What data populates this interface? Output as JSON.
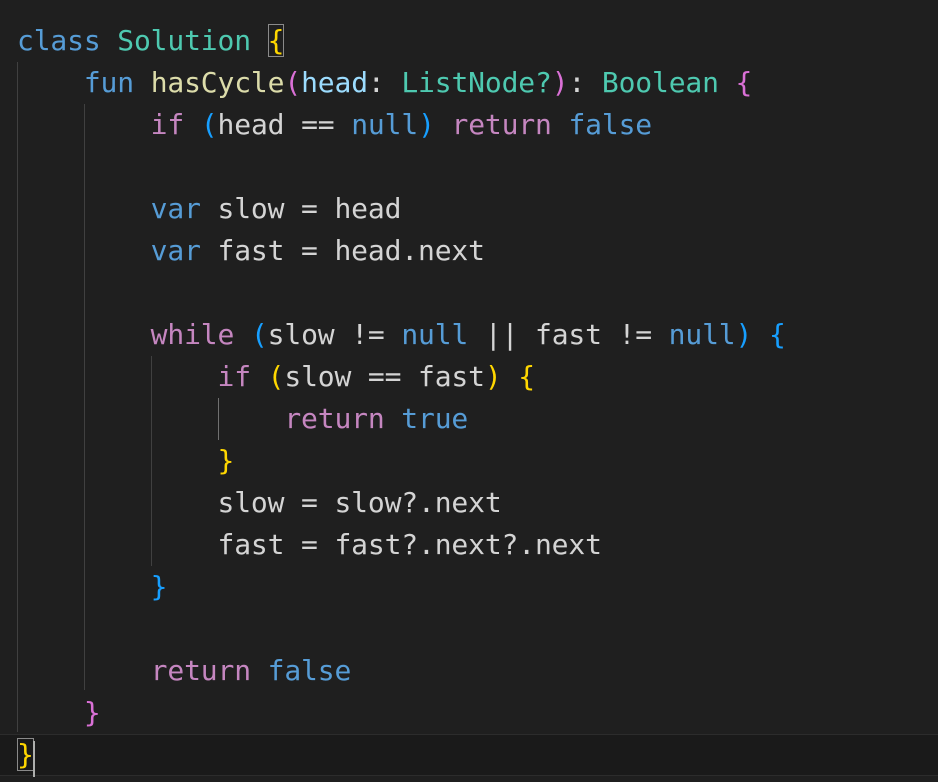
{
  "editor": {
    "language": "kotlin",
    "theme_colors": {
      "background": "#1f1f1f",
      "keyword_blue": "#569cd6",
      "keyword_control": "#c586c0",
      "type": "#4ec9b0",
      "function": "#dcdcaa",
      "parameter": "#9cdcfe",
      "text": "#d4d4d4",
      "bracket_level_1": "#ffd700",
      "bracket_level_2": "#da70d6",
      "bracket_level_3": "#179fff"
    },
    "lines": [
      {
        "tokens": [
          [
            "class",
            "kw-blue"
          ],
          [
            " ",
            "plain"
          ],
          [
            "Solution",
            "type"
          ],
          [
            " ",
            "plain"
          ],
          [
            "{",
            "b1"
          ]
        ]
      },
      {
        "tokens": [
          [
            "    ",
            "plain"
          ],
          [
            "fun",
            "kw-blue"
          ],
          [
            " ",
            "plain"
          ],
          [
            "hasCycle",
            "fn"
          ],
          [
            "(",
            "b2"
          ],
          [
            "head",
            "param"
          ],
          [
            ": ",
            "plain"
          ],
          [
            "ListNode?",
            "type"
          ],
          [
            ")",
            "b2"
          ],
          [
            ": ",
            "plain"
          ],
          [
            "Boolean",
            "type"
          ],
          [
            " ",
            "plain"
          ],
          [
            "{",
            "b2"
          ]
        ]
      },
      {
        "tokens": [
          [
            "        ",
            "plain"
          ],
          [
            "if",
            "kw-purple"
          ],
          [
            " ",
            "plain"
          ],
          [
            "(",
            "b3"
          ],
          [
            "head",
            "plain"
          ],
          [
            " == ",
            "plain"
          ],
          [
            "null",
            "kw-blue"
          ],
          [
            ")",
            "b3"
          ],
          [
            " ",
            "plain"
          ],
          [
            "return",
            "kw-purple"
          ],
          [
            " ",
            "plain"
          ],
          [
            "false",
            "kw-blue"
          ]
        ]
      },
      {
        "tokens": []
      },
      {
        "tokens": [
          [
            "        ",
            "plain"
          ],
          [
            "var",
            "kw-blue"
          ],
          [
            " slow = head",
            "plain"
          ]
        ]
      },
      {
        "tokens": [
          [
            "        ",
            "plain"
          ],
          [
            "var",
            "kw-blue"
          ],
          [
            " fast = head.next",
            "plain"
          ]
        ]
      },
      {
        "tokens": []
      },
      {
        "tokens": [
          [
            "        ",
            "plain"
          ],
          [
            "while",
            "kw-purple"
          ],
          [
            " ",
            "plain"
          ],
          [
            "(",
            "b3"
          ],
          [
            "slow != ",
            "plain"
          ],
          [
            "null",
            "kw-blue"
          ],
          [
            " || fast != ",
            "plain"
          ],
          [
            "null",
            "kw-blue"
          ],
          [
            ")",
            "b3"
          ],
          [
            " ",
            "plain"
          ],
          [
            "{",
            "b3"
          ]
        ]
      },
      {
        "tokens": [
          [
            "            ",
            "plain"
          ],
          [
            "if",
            "kw-purple"
          ],
          [
            " ",
            "plain"
          ],
          [
            "(",
            "b1"
          ],
          [
            "slow == fast",
            "plain"
          ],
          [
            ")",
            "b1"
          ],
          [
            " ",
            "plain"
          ],
          [
            "{",
            "b1"
          ]
        ]
      },
      {
        "tokens": [
          [
            "                ",
            "plain"
          ],
          [
            "return",
            "kw-purple"
          ],
          [
            " ",
            "plain"
          ],
          [
            "true",
            "kw-blue"
          ]
        ]
      },
      {
        "tokens": [
          [
            "            ",
            "plain"
          ],
          [
            "}",
            "b1"
          ]
        ]
      },
      {
        "tokens": [
          [
            "            ",
            "plain"
          ],
          [
            "slow = slow?.next",
            "plain"
          ]
        ]
      },
      {
        "tokens": [
          [
            "            ",
            "plain"
          ],
          [
            "fast = fast?.next?.next",
            "plain"
          ]
        ]
      },
      {
        "tokens": [
          [
            "        ",
            "plain"
          ],
          [
            "}",
            "b3"
          ]
        ]
      },
      {
        "tokens": []
      },
      {
        "tokens": [
          [
            "        ",
            "plain"
          ],
          [
            "return",
            "kw-purple"
          ],
          [
            " ",
            "plain"
          ],
          [
            "false",
            "kw-blue"
          ]
        ]
      },
      {
        "tokens": [
          [
            "    ",
            "plain"
          ],
          [
            "}",
            "b2"
          ]
        ]
      },
      {
        "tokens": [
          [
            "}",
            "b1"
          ]
        ]
      }
    ]
  }
}
